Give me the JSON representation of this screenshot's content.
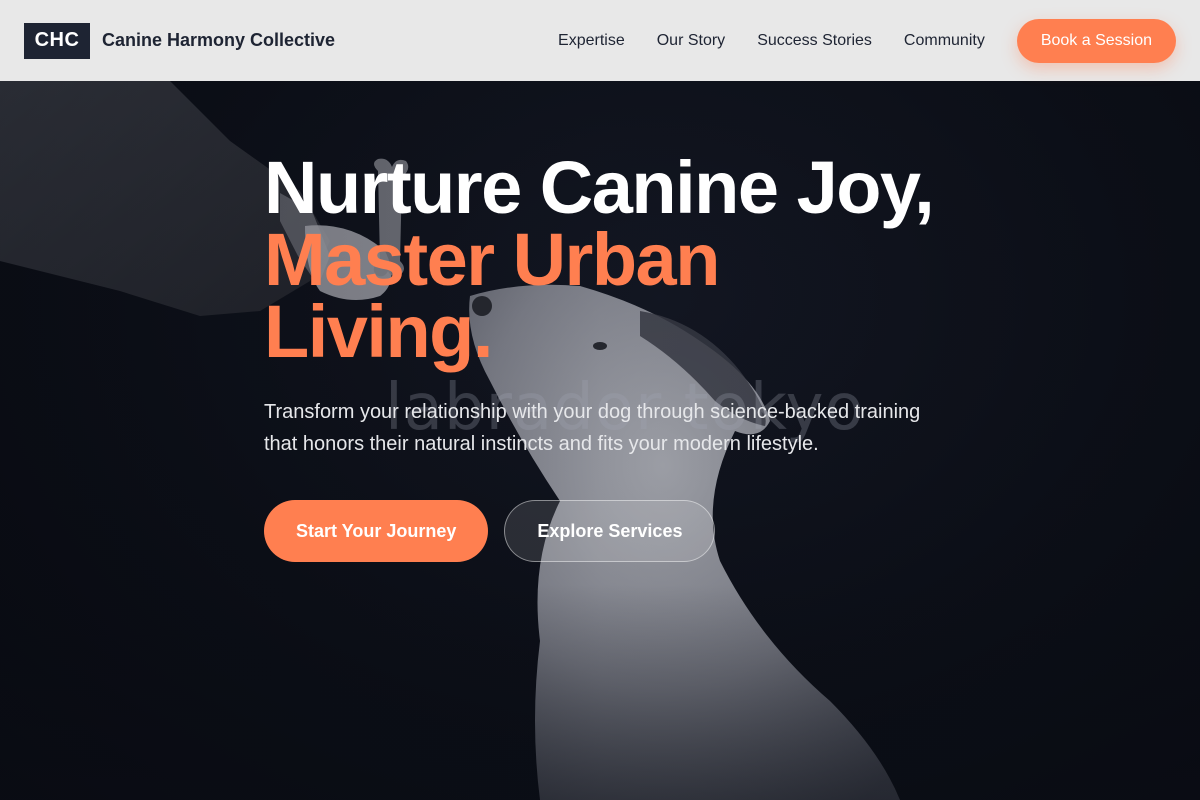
{
  "header": {
    "logo_text": "CHC",
    "brand_name": "Canine Harmony Collective",
    "nav": [
      {
        "label": "Expertise"
      },
      {
        "label": "Our Story"
      },
      {
        "label": "Success Stories"
      },
      {
        "label": "Community"
      }
    ],
    "cta_label": "Book a Session"
  },
  "hero": {
    "headline_line1": "Nurture Canine Joy,",
    "headline_line2": "Master Urban",
    "headline_line3": "Living.",
    "watermark": "labrador tokyo",
    "subtitle": "Transform your relationship with your dog through science-backed training that honors their natural instincts and fits your modern lifestyle.",
    "primary_cta": "Start Your Journey",
    "secondary_cta": "Explore Services",
    "background_image": "hand-holding-bone-treat-above-dog"
  },
  "colors": {
    "accent": "#ff7f50",
    "header_bg": "#e8e8e8",
    "logo_bg": "#1e2433",
    "hero_bg": "#0b0e16",
    "text_dark": "#1e2433"
  }
}
